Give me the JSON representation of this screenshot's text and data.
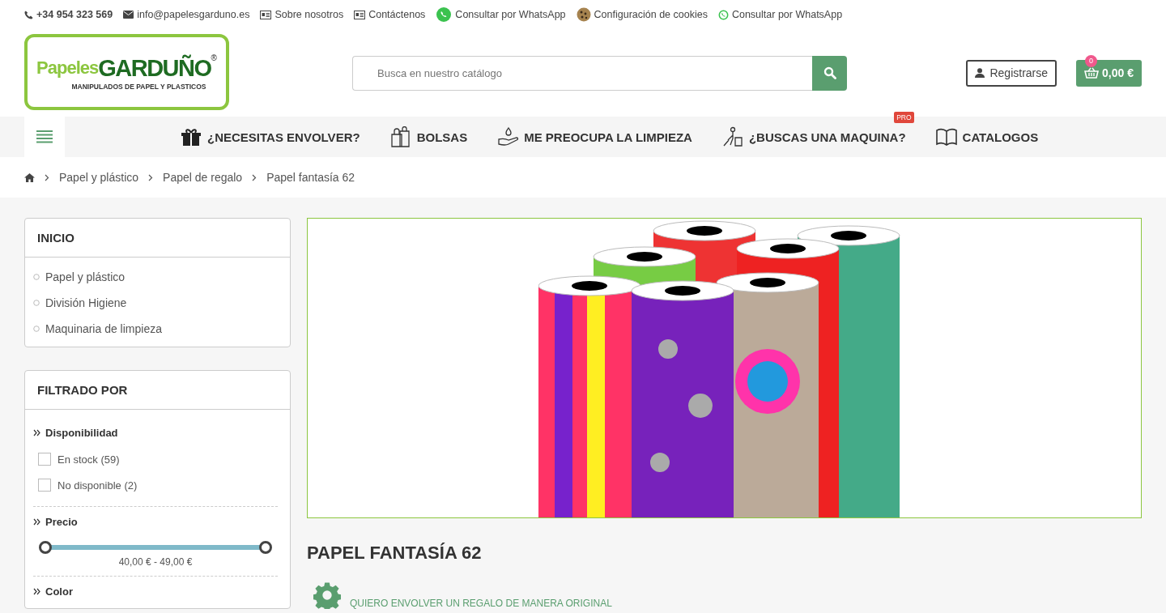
{
  "top_bar": [
    {
      "kind": "phone",
      "label": "+34 954 323 569"
    },
    {
      "kind": "mail",
      "label": "info@papelesgarduno.es"
    },
    {
      "kind": "card",
      "label": "Sobre nosotros"
    },
    {
      "kind": "card",
      "label": "Contáctenos"
    },
    {
      "kind": "whatsapp",
      "label": "Consultar por WhatsApp"
    },
    {
      "kind": "cookie",
      "label": "Configuración de cookies"
    },
    {
      "kind": "whatsapp-small",
      "label": "Consultar por WhatsApp"
    }
  ],
  "logo": {
    "light": "Papeles",
    "bold": "GARDUÑO",
    "mark": "®",
    "tagline": "MANIPULADOS DE PAPEL Y PLASTICOS"
  },
  "search": {
    "placeholder": "Busca en nuestro catálogo"
  },
  "account": {
    "label": "Registrarse"
  },
  "cart": {
    "count": "0",
    "total": "0,00 €"
  },
  "menu": [
    {
      "kind": "gift",
      "label": "¿NECESITAS ENVOLVER?"
    },
    {
      "kind": "bags",
      "label": "BOLSAS"
    },
    {
      "kind": "wash",
      "label": "ME PREOCUPA LA LIMPIEZA"
    },
    {
      "kind": "machine",
      "label": "¿BUSCAS UNA MAQUINA?",
      "badge": "PRO"
    },
    {
      "kind": "book",
      "label": "CATALOGOS"
    }
  ],
  "breadcrumb": [
    "Papel y plástico",
    "Papel de regalo",
    "Papel fantasía 62"
  ],
  "sidebar": {
    "categories": {
      "title": "INICIO",
      "items": [
        "Papel y plástico",
        "División Higiene",
        "Maquinaria de limpieza"
      ]
    },
    "filters": {
      "title": "FILTRADO POR",
      "groups": [
        {
          "kind": "checkboxes",
          "title": "Disponibilidad",
          "options": [
            {
              "label": "En stock (59)",
              "checked": false
            },
            {
              "label": "No disponible (2)",
              "checked": false
            }
          ]
        },
        {
          "kind": "range",
          "title": "Precio",
          "level": 1,
          "reading": "40,00 € - 49,00 €"
        },
        {
          "kind": "heading",
          "title": "Color"
        }
      ]
    }
  },
  "product": {
    "title": "PAPEL FANTASÍA 62",
    "link": "QUIERO ENVOLVER UN REGALO DE MANERA ORIGINAL"
  }
}
